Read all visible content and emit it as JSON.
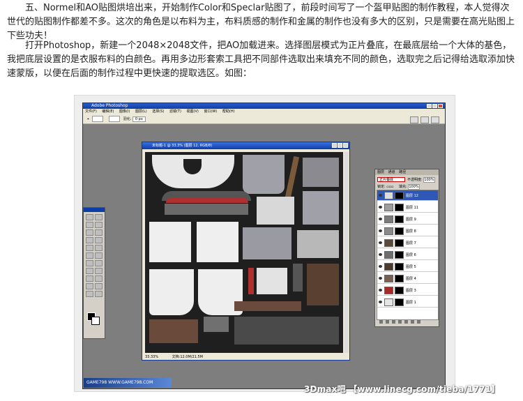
{
  "article": {
    "paragraph1": "五、Normel和AO贴图烘培出来，开始制作Color和Speclar贴图了，前段时间写了一个盔甲贴图的制作教程，本人觉得次世代的贴图制作都差不多。这次的角色是以布料为主，布料质感的制作和金属的制作也没有多大的区别，只是需要在高光贴图上下些功夫！",
    "paragraph2": "打开Photoshop，新建一个2048×2048文件，把AO加载进来。选择图层模式为正片叠底，在最底层给一个大体的基色，我把底层设置的是衣服布料的白颜色。再用多边形套索工具把不同部件选取出来填充不同的颜色，选取完之后记得给选取添加快速蒙版，以便在后面的制作过程中更快速的提取选区。如图："
  },
  "photoshop": {
    "app_title": "Adobe Photoshop",
    "menu": [
      "文件(F)",
      "编辑(E)",
      "图像(I)",
      "图层(L)",
      "选择(S)",
      "滤镜(T)",
      "视图(V)",
      "窗口(W)",
      "帮助(H)"
    ],
    "options_label": "羽化:",
    "options_value": "0 px",
    "document_title": "未标题-1 @ 33.3% (图层 12, RGB/8)",
    "zoom": "33.33%",
    "doc_info": "文档:12.0M/21.5M"
  },
  "layers_panel": {
    "tabs": [
      "图层",
      "通道",
      "路径"
    ],
    "blend_mode": "正片叠底",
    "opacity_label": "不透明度:",
    "opacity": "100%",
    "lock_label": "锁定:",
    "fill_label": "填充:",
    "fill": "100%",
    "layers": [
      {
        "name": "图层 12",
        "color": "#dcdcdc",
        "selected": true
      },
      {
        "name": "图层 11",
        "color": "#9e9e9e",
        "selected": false
      },
      {
        "name": "图层 9",
        "color": "#7a7a7a",
        "selected": false
      },
      {
        "name": "图层 8",
        "color": "#8a8a8a",
        "selected": false
      },
      {
        "name": "图层 7",
        "color": "#5a4a3a",
        "selected": false
      },
      {
        "name": "图层 6",
        "color": "#6e6e6e",
        "selected": false
      },
      {
        "name": "图层 5",
        "color": "#4a3a30",
        "selected": false
      },
      {
        "name": "图层 4",
        "color": "#7a6052",
        "selected": false
      },
      {
        "name": "图层 3",
        "color": "#a22a2a",
        "selected": false
      },
      {
        "name": "图层 1",
        "color": "#e5e5e5",
        "selected": false
      }
    ]
  },
  "branding": {
    "game_logo": "GAME798 WWW.GAME798.COM",
    "watermark": "3Dmax吧 【www.linecg.com/tieba/1771】"
  }
}
